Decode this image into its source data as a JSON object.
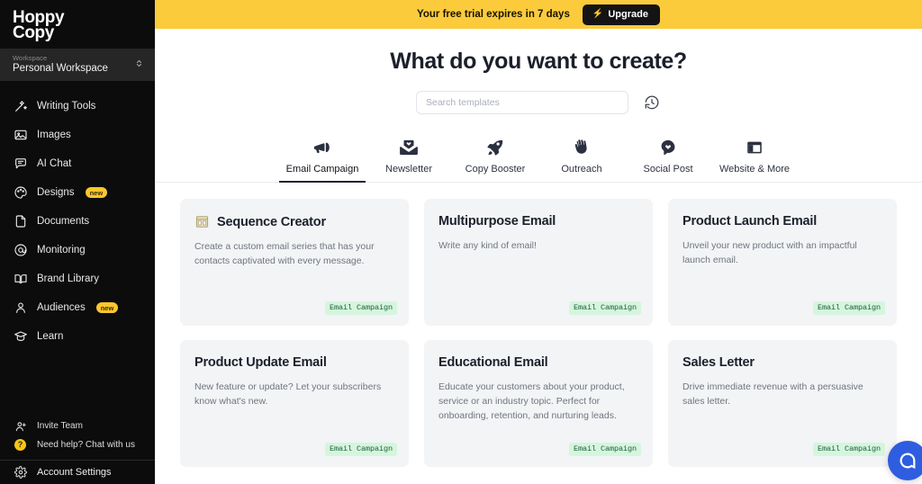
{
  "sidebar": {
    "brand": {
      "line1": "Hoppy",
      "line2": "Copy"
    },
    "workspace": {
      "label": "Workspace",
      "name": "Personal Workspace",
      "chevron": "chevron-updown-icon"
    },
    "items": [
      {
        "label": "Writing Tools",
        "icon": "magic-wand-icon",
        "badge": ""
      },
      {
        "label": "Images",
        "icon": "image-icon",
        "badge": ""
      },
      {
        "label": "AI Chat",
        "icon": "chat-bubble-icon",
        "badge": ""
      },
      {
        "label": "Designs",
        "icon": "palette-icon",
        "badge": "new"
      },
      {
        "label": "Documents",
        "icon": "document-icon",
        "badge": ""
      },
      {
        "label": "Monitoring",
        "icon": "at-sign-icon",
        "badge": ""
      },
      {
        "label": "Brand Library",
        "icon": "book-open-icon",
        "badge": ""
      },
      {
        "label": "Audiences",
        "icon": "user-icon",
        "badge": "new"
      },
      {
        "label": "Learn",
        "icon": "graduation-cap-icon",
        "badge": ""
      }
    ],
    "footer": {
      "invite": {
        "label": "Invite Team",
        "icon": "user-plus-icon"
      },
      "help": {
        "label": "Need help? Chat with us",
        "icon": "question-mark-icon",
        "glyph": "?"
      },
      "account": {
        "label": "Account Settings",
        "icon": "gear-icon"
      }
    }
  },
  "trial": {
    "text": "Your free trial expires in 7 days",
    "upgrade_label": "Upgrade",
    "bolt": "⚡",
    "bg_color": "#fbcb3c"
  },
  "hero": {
    "title": "What do you want to create?"
  },
  "search": {
    "value": "",
    "placeholder": "Search templates",
    "history_icon": "history-clock-icon"
  },
  "tabs": [
    {
      "label": "Email Campaign",
      "icon": "megaphone-icon",
      "active": true
    },
    {
      "label": "Newsletter",
      "icon": "envelope-heart-icon",
      "active": false
    },
    {
      "label": "Copy Booster",
      "icon": "rocket-icon",
      "active": false
    },
    {
      "label": "Outreach",
      "icon": "waving-hand-icon",
      "active": false
    },
    {
      "label": "Social Post",
      "icon": "speech-bubble-heart-icon",
      "active": false
    },
    {
      "label": "Website & More",
      "icon": "browser-window-icon",
      "active": false
    }
  ],
  "cards": [
    {
      "title": "Sequence Creator",
      "desc": "Create a custom email series that has your contacts captivated with every message.",
      "tag": "Email Campaign",
      "icon": "sequence-grid-icon"
    },
    {
      "title": "Multipurpose Email",
      "desc": "Write any kind of email!",
      "tag": "Email Campaign",
      "icon": ""
    },
    {
      "title": "Product Launch Email",
      "desc": "Unveil your new product with an impactful launch email.",
      "tag": "Email Campaign",
      "icon": ""
    },
    {
      "title": "Product Update Email",
      "desc": "New feature or update? Let your subscribers know what's new.",
      "tag": "Email Campaign",
      "icon": ""
    },
    {
      "title": "Educational Email",
      "desc": "Educate your customers about your product, service or an industry topic. Perfect for onboarding, retention, and nurturing leads.",
      "tag": "Email Campaign",
      "icon": ""
    },
    {
      "title": "Sales Letter",
      "desc": "Drive immediate revenue with a persuasive sales letter.",
      "tag": "Email Campaign",
      "icon": ""
    }
  ],
  "chat_widget": {
    "icon": "support-chat-icon",
    "color": "#2f5de0"
  },
  "colors": {
    "sidebar_bg": "#0c0c0c",
    "accent_yellow": "#fbcb3c",
    "tag_bg": "#d6f5dd",
    "tag_text": "#19603a",
    "card_bg": "#f2f4f6"
  }
}
